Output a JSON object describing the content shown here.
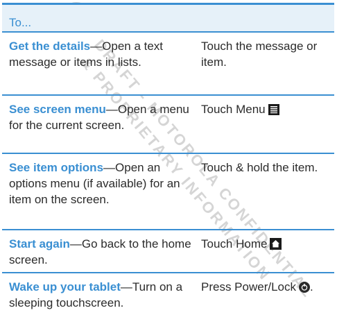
{
  "header": {
    "label": "To..."
  },
  "rows": [
    {
      "title": "Get the details",
      "desc": "—Open a text message or items in lists.",
      "action": "Touch the message or item."
    },
    {
      "title": "See screen menu",
      "desc": "—Open a menu for the current screen.",
      "action": "Touch Menu",
      "icon": "menu-icon"
    },
    {
      "title": "See item options",
      "desc": "—Open an options menu (if available) for an item on the screen.",
      "action": "Touch & hold the item."
    },
    {
      "title": "Start again",
      "desc": "—Go back to the home screen.",
      "action": "Touch Home",
      "icon": "home-icon"
    },
    {
      "title": "Wake up your tablet",
      "desc": "—Turn on a sleeping touchscreen.",
      "action": "Press Power/Lock",
      "icon": "power-lock-icon",
      "action_suffix": "."
    }
  ],
  "watermark": {
    "line1": "DRAFT - MOTOROLA CONFIDENTIAL",
    "line2": "& PROPRIETARY INFORMATION"
  },
  "colors": {
    "accent": "#3a8fd2",
    "header_bg": "#e6f1f9",
    "text": "#2b2b2b"
  }
}
